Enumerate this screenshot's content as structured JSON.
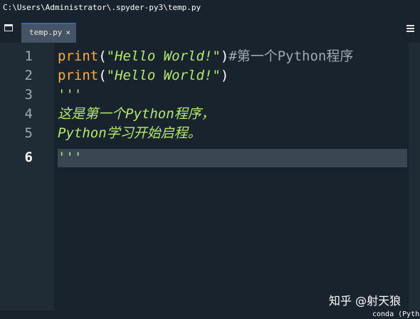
{
  "window": {
    "path": "C:\\Users\\Administrator\\.spyder-py3\\temp.py"
  },
  "tabs": [
    {
      "label": "temp.py",
      "close": "×"
    }
  ],
  "editor": {
    "line_numbers": [
      "1",
      "2",
      "3",
      "4",
      "5",
      "6"
    ],
    "current_line": "6",
    "lines": [
      {
        "kw": "print",
        "open": "(",
        "str": "\"Hello World!\"",
        "close": ")",
        "comment": "#第一个Python程序"
      },
      {
        "kw": "print",
        "open": "(",
        "str": "\"Hello World!\"",
        "close": ")"
      },
      {
        "doc": "'''"
      },
      {
        "doc": "这是第一个Python程序，"
      },
      {
        "doc": "Python学习开始启程。"
      },
      {
        "doc": "'''"
      }
    ]
  },
  "statusbar": {
    "conda": "conda (Pyth"
  },
  "watermark": "知乎 @射天狼",
  "colors": {
    "background": "#19232d",
    "keyword": "#ffab40",
    "string": "#b3e86f",
    "comment": "#a0a8b0",
    "tab_accent": "#1a72bb"
  },
  "icons": {
    "panel": "panel-icon",
    "menu": "hamburger-menu-icon"
  }
}
